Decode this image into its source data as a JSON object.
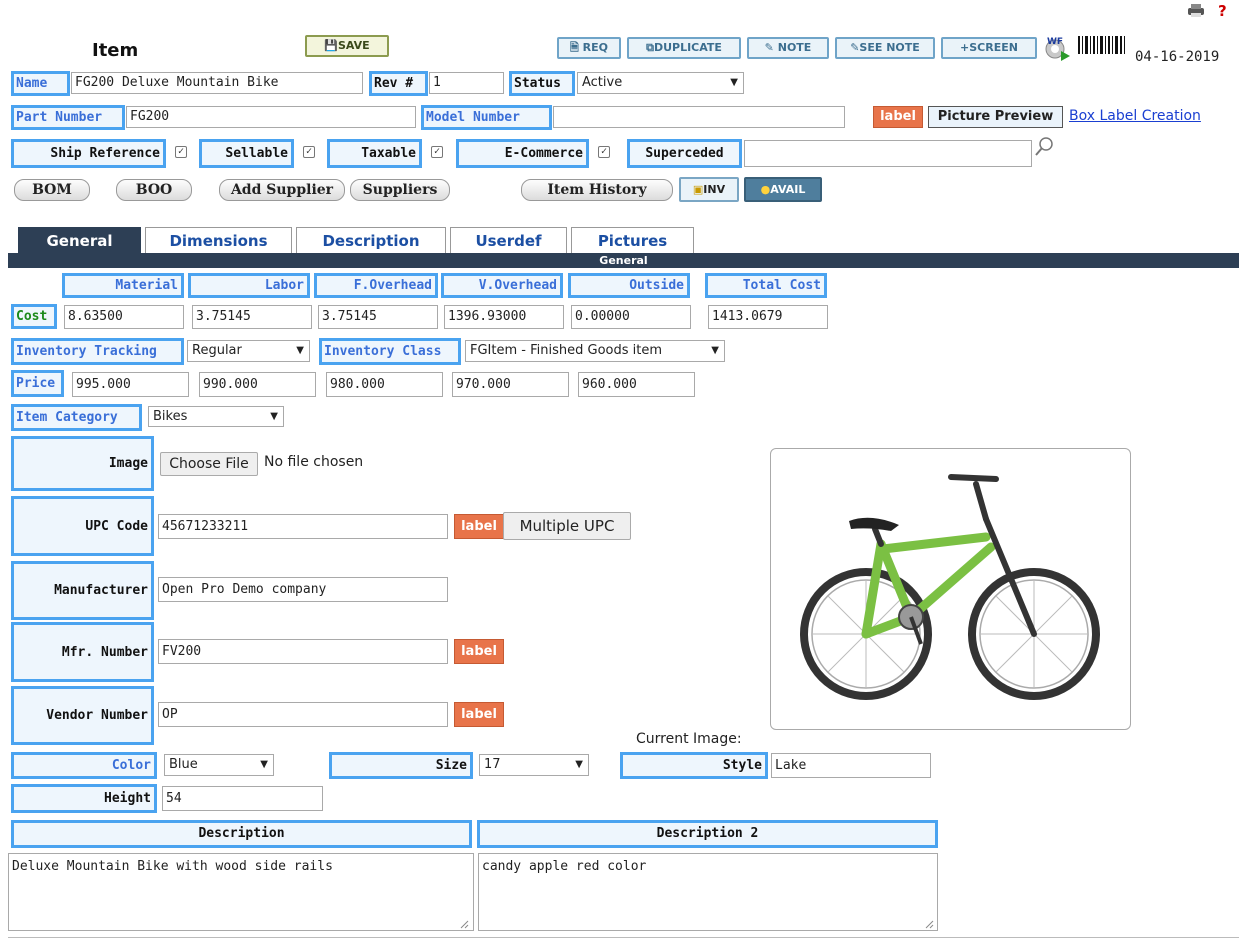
{
  "header": {
    "title": "Item",
    "save_label": "SAVE",
    "date": "04-16-2019",
    "help": "?",
    "toolbar": {
      "req": "REQ",
      "duplicate": "DUPLICATE",
      "note": "NOTE",
      "see_note": "SEE NOTE",
      "screen": "+SCREEN",
      "wf": "WF",
      "barcode": "|||||||||"
    }
  },
  "form": {
    "name_label": "Name",
    "name_value": "FG200 Deluxe Mountain Bike",
    "rev_label": "Rev #",
    "rev_value": "1",
    "status_label": "Status",
    "status_value": "Active",
    "part_number_label": "Part Number",
    "part_number_value": "FG200",
    "model_number_label": "Model Number",
    "model_number_value": "",
    "label_btn": "label",
    "picture_preview": "Picture Preview",
    "box_label_creation": "Box Label Creation",
    "ship_reference_label": "Ship Reference",
    "sellable_label": "Sellable",
    "taxable_label": "Taxable",
    "ecommerce_label": "E-Commerce",
    "superceded_label": "Superceded",
    "superceded_value": ""
  },
  "buttons": {
    "bom": "BOM",
    "boo": "BOO",
    "add_supplier": "Add Supplier",
    "suppliers": "Suppliers",
    "item_history": "Item History",
    "inv": "INV",
    "avail": "AVAIL"
  },
  "tabs": [
    "General",
    "Dimensions",
    "Description",
    "Userdef",
    "Pictures"
  ],
  "general_bar": "General",
  "costs": {
    "headers": [
      "Material",
      "Labor",
      "F.Overhead",
      "V.Overhead",
      "Outside",
      "Total Cost"
    ],
    "row_label": "Cost",
    "values": [
      "8.63500",
      "3.75145",
      "3.75145",
      "1396.93000",
      "0.00000",
      "1413.0679"
    ]
  },
  "inventory": {
    "tracking_label": "Inventory Tracking",
    "tracking_value": "Regular",
    "class_label": "Inventory Class",
    "class_value": "FGItem - Finished Goods item"
  },
  "price": {
    "label": "Price",
    "values": [
      "995.000",
      "990.000",
      "980.000",
      "970.000",
      "960.000"
    ]
  },
  "category": {
    "label": "Item Category",
    "value": "Bikes"
  },
  "details": {
    "image_label": "Image",
    "choose_file": "Choose File",
    "no_file": "No file chosen",
    "upc_label": "UPC Code",
    "upc_value": "45671233211",
    "multiple_upc": "Multiple UPC",
    "manufacturer_label": "Manufacturer",
    "manufacturer_value": "Open Pro Demo company",
    "mfr_number_label": "Mfr. Number",
    "mfr_number_value": "FV200",
    "vendor_number_label": "Vendor Number",
    "vendor_number_value": "OP",
    "current_image": "Current Image:"
  },
  "attributes": {
    "color_label": "Color",
    "color_value": "Blue",
    "size_label": "Size",
    "size_value": "17",
    "style_label": "Style",
    "style_value": "Lake",
    "height_label": "Height",
    "height_value": "54"
  },
  "descriptions": {
    "desc_label": "Description",
    "desc_value": "Deluxe Mountain Bike with wood side rails",
    "desc2_label": "Description 2",
    "desc2_value": "candy apple red color"
  },
  "colors": {
    "label_border": "#4aa3f0",
    "label_text": "#3a6fd8",
    "tab_active": "#2d3f55",
    "orange_label": "#e8744a",
    "bike_green": "#7bc043"
  }
}
